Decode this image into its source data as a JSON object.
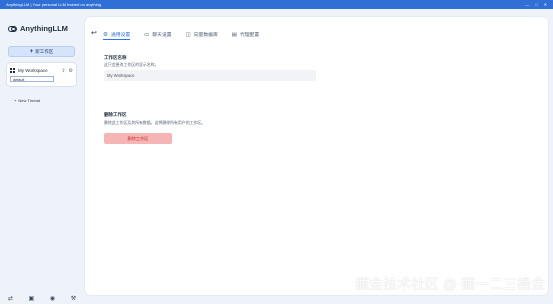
{
  "window": {
    "title": "AnythingLLM | Your personal LLM trained on anything",
    "controls": [
      "—",
      "□",
      "✕"
    ]
  },
  "sidebar": {
    "app_name": "AnythingLLM",
    "new_workspace_label": "新工作区",
    "workspace": {
      "name": "My Workspace",
      "upload_icon": "upload-icon",
      "settings_icon": "gear-icon",
      "default_thread": "default"
    },
    "new_thread_label": "New Thread",
    "footer_icons": [
      "support-icon",
      "docs-icon",
      "discord-icon",
      "settings-icon"
    ]
  },
  "main": {
    "tabs": [
      {
        "label": "通用设置",
        "icon": "wrench-icon",
        "active": true
      },
      {
        "label": "聊天设置",
        "icon": "chat-icon",
        "active": false
      },
      {
        "label": "向量数据库",
        "icon": "database-icon",
        "active": false
      },
      {
        "label": "代理配置",
        "icon": "agent-icon",
        "active": false
      }
    ],
    "workspace_name_section": {
      "title": "工作区名称",
      "description": "这只会更改工作区的显示名称。",
      "value": "My Workspace"
    },
    "delete_section": {
      "title": "删除工作区",
      "description": "删除此工作区及其所有数据。这将删除所有用户的工作区。",
      "button_label": "删除工作区"
    }
  },
  "colors": {
    "accent": "#2d73e5",
    "titlebar": "#2f6fd6",
    "delete_bg": "#f6b5b5",
    "delete_text": "#c62828"
  },
  "watermark": "掘金技术社区 @ 掘一二三桶金"
}
